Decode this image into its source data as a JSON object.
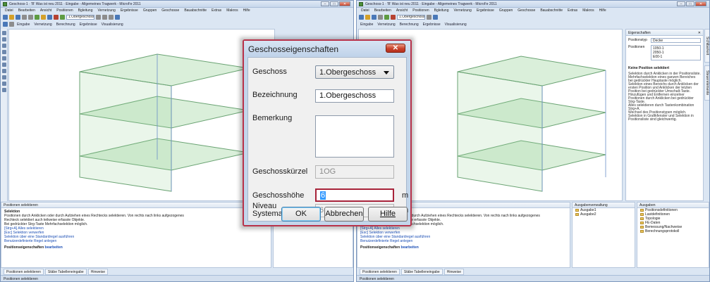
{
  "window": {
    "title": "Geschoss-1 · 'B' Was ist neu 2011 · Eingabe - Allgemeines Tragwerk - MicroFe 2011",
    "menus": [
      "Datei",
      "Bearbeiten",
      "Ansicht",
      "Positionen",
      "Bgleitung",
      "Vernetzung",
      "Ergebnisse",
      "Gruppen",
      "Geschosse",
      "Bauabschnitte",
      "Extras",
      "Makros",
      "Hilfe"
    ],
    "toolbar_floor": "1.Obergeschoss",
    "toolbar_tabs": [
      "Eingabe",
      "Vernetzung",
      "Berechnung",
      "Ergebnisse",
      "Visualisierung"
    ]
  },
  "properties_panel": {
    "title": "Eigenschaften",
    "positionstyp_label": "Positionstyp",
    "positionstyp_value": "Decke",
    "positionen_label": "Positionen",
    "positionen": [
      "1050-1",
      "2050-1",
      "E00-1"
    ],
    "none_title": "Keine Position selektiert",
    "hints": [
      "Selektion durch Anklicken in der Positionsliste.",
      "Mehrfachselektion eines ganzen Bereiches bei gedrückter Hauptaste möglich.",
      "Selektion eines Bereichs durch Anklicken der ersten Position und Anklicken der letzten Position bei gedrückter Umschalt-Taste.",
      "Hinzufügen und Entfernen einzelner Positionen durch Anklicken bei gedrückter Strg-Taste.",
      "Alles selektieren durch Tastenkombination Strg+A.",
      "Wechsel des Positionstypen möglich.",
      "Selektion in Grafikfenster und Selektion in Positionsliste sind gleichwertig."
    ],
    "side_tabs": [
      "Sichtbarkeit",
      "Steuerelemente"
    ]
  },
  "select_panel": {
    "title": "Positionen selektieren",
    "heading": "Selektion",
    "lines": [
      "Positionen durch Anklicken oder durch Aufziehen eines Rechtecks selektieren. Von rechts nach links aufgezogenes",
      "Rechteck selektiert auch teilweise erfasste Objekte.",
      "Bei gedrückter Strg-Taste Mehrfachselektion möglich.",
      "[Strg+A] Alles selektieren",
      "[Esc] Selektion verwerfen",
      "Selektion über eine Standardregel ausführen",
      "Benutzerdefinierte Regel anlegen"
    ],
    "props_label": "Positionseigenschaften",
    "props_link": "bearbeiten"
  },
  "output_panel": {
    "title": "Ausgabenverwaltung",
    "items": [
      "Ausgabe1",
      "Ausgabe2"
    ]
  },
  "outputs_tree": {
    "title": "Ausgaben",
    "items": [
      "Positionsdefinitionen",
      "Lastdefinitionen",
      "Topologie",
      "FE-Daten",
      "Bemessung/Nachweise",
      "Berechnungsprotokoll"
    ]
  },
  "nav_tabs": [
    "Positionen selektieren",
    "Stäbe Tabelleneingabe",
    "Hinweise"
  ],
  "status_text": "Positionen selektieren",
  "dialog": {
    "title": "Geschosseigenschaften",
    "close_label": "✕",
    "geschoss_label": "Geschoss",
    "geschoss_value": "1.Obergeschoss",
    "bezeichnung_label": "Bezeichnung",
    "bezeichnung_value": "1.Obergeschoss",
    "bemerkung_label": "Bemerkung",
    "bemerkung_value": "",
    "kuerzel_label": "Geschosskürzel",
    "kuerzel_value": "1OG",
    "hoehe_label": "Geschosshöhe",
    "hoehe_value": "6",
    "hoehe_unit": "m",
    "niveau_label_1": "Niveau",
    "niveau_label_2": "Systemachse",
    "niveau_value": "6",
    "niveau_unit": "m",
    "ok_label": "OK",
    "cancel_label": "Abbrechen",
    "help_label": "Hilfe"
  }
}
